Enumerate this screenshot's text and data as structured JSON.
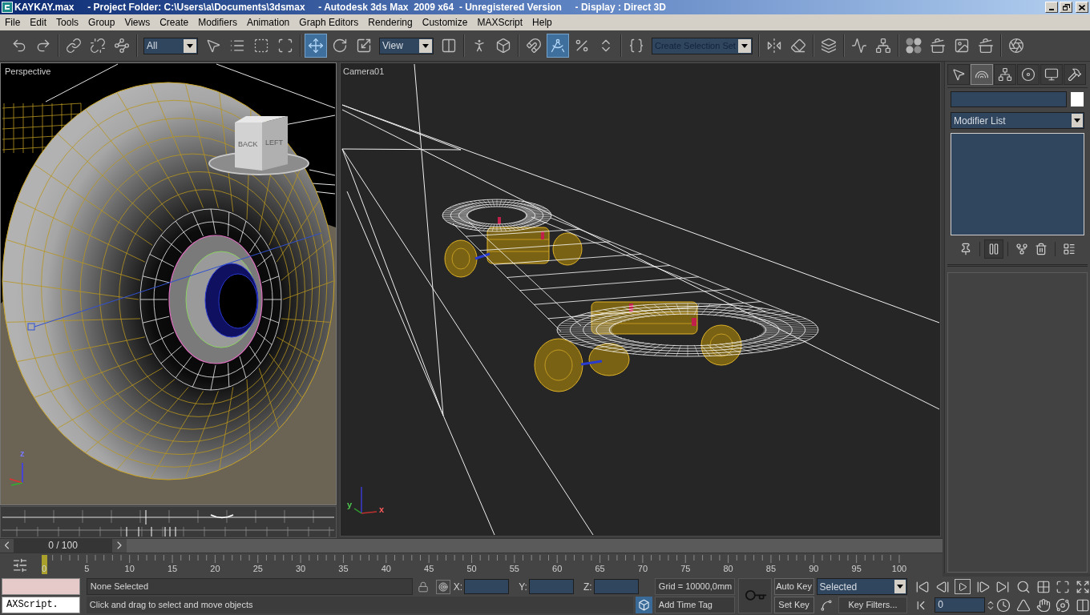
{
  "window": {
    "title": "KAYKAY.max     - Project Folder: C:\\Users\\a\\Documents\\3dsmax     - Autodesk 3ds Max  2009 x64  - Unregistered Version     - Display : Direct 3D"
  },
  "menu": [
    "File",
    "Edit",
    "Tools",
    "Group",
    "Views",
    "Create",
    "Modifiers",
    "Animation",
    "Graph Editors",
    "Rendering",
    "Customize",
    "MAXScript",
    "Help"
  ],
  "toolbar": [
    [
      {
        "kind": "button",
        "selected": false
      },
      {
        "kind": "button",
        "selected": false
      }
    ],
    [
      {
        "kind": "button",
        "selected": false
      },
      {
        "kind": "button",
        "selected": false
      },
      {
        "kind": "button",
        "selected": false
      }
    ],
    [
      {
        "kind": "dropdown",
        "value": "All"
      },
      {
        "kind": "button",
        "selected": false
      },
      {
        "kind": "button",
        "selected": false
      },
      {
        "kind": "button",
        "selected": false
      },
      {
        "kind": "button",
        "selected": false
      }
    ],
    [
      {
        "kind": "button",
        "selected": true
      },
      {
        "kind": "button",
        "selected": false
      },
      {
        "kind": "button",
        "selected": false
      },
      {
        "kind": "dropdown",
        "value": "View"
      },
      {
        "kind": "button",
        "selected": false
      }
    ],
    [
      {
        "kind": "button",
        "selected": false
      },
      {
        "kind": "button",
        "selected": false
      }
    ],
    [
      {
        "kind": "button",
        "selected": false
      },
      {
        "kind": "button",
        "selected": true
      },
      {
        "kind": "button",
        "selected": false
      },
      {
        "kind": "button",
        "selected": false
      }
    ],
    [
      {
        "kind": "button",
        "selected": false
      },
      {
        "kind": "dropdown",
        "placeholder": "Create Selection Set"
      }
    ],
    [
      {
        "kind": "button",
        "selected": false
      },
      {
        "kind": "button",
        "selected": false
      }
    ],
    [
      {
        "kind": "button",
        "selected": false
      }
    ],
    [
      {
        "kind": "button",
        "selected": false
      },
      {
        "kind": "button",
        "selected": false
      }
    ],
    [
      {
        "kind": "button",
        "selected": false
      },
      {
        "kind": "button",
        "selected": false
      },
      {
        "kind": "button",
        "selected": false
      },
      {
        "kind": "button",
        "selected": false
      }
    ],
    [
      {
        "kind": "button",
        "selected": false
      }
    ]
  ],
  "viewports": [
    {
      "kind": "perspective",
      "label": "Perspective",
      "viewcube": [
        "BACK",
        "LEFT"
      ],
      "axis_labels": [
        "z"
      ]
    },
    {
      "kind": "camera",
      "label": "Camera01",
      "axis_labels": [
        "y",
        "x"
      ]
    }
  ],
  "command_panel": {
    "tabs": [
      {
        "selected": false
      },
      {
        "selected": true
      },
      {
        "selected": false
      },
      {
        "selected": false
      },
      {
        "selected": false
      },
      {
        "selected": false
      }
    ],
    "modifier_list": "Modifier List",
    "stack_buttons": [
      {
        "on": false
      },
      {
        "on": true
      },
      {
        "on": false
      },
      {
        "on": false
      },
      {
        "on": false
      }
    ]
  },
  "time_slider": {
    "label": "0 / 100",
    "level": 0
  },
  "track_bar": {
    "ticks": [
      "0",
      "5",
      "10",
      "15",
      "20",
      "25",
      "30",
      "35",
      "40",
      "45",
      "50",
      "55",
      "60",
      "65",
      "70",
      "75",
      "80",
      "85",
      "90",
      "95",
      "100"
    ]
  },
  "status": {
    "listener": "AXScript.",
    "selection": "None Selected",
    "prompt": "Click and drag to select and move objects",
    "coordinates": [
      "X:",
      "Y:",
      "Z:"
    ],
    "grid": "Grid = 10000,0mm",
    "time_tag": "Add Time Tag"
  },
  "animation": {
    "auto_key": {
      "label": "Auto Key",
      "on": false
    },
    "set_key": "Set Key",
    "key_set": "Selected",
    "key_filters": "Key Filters...",
    "frame": "0"
  }
}
